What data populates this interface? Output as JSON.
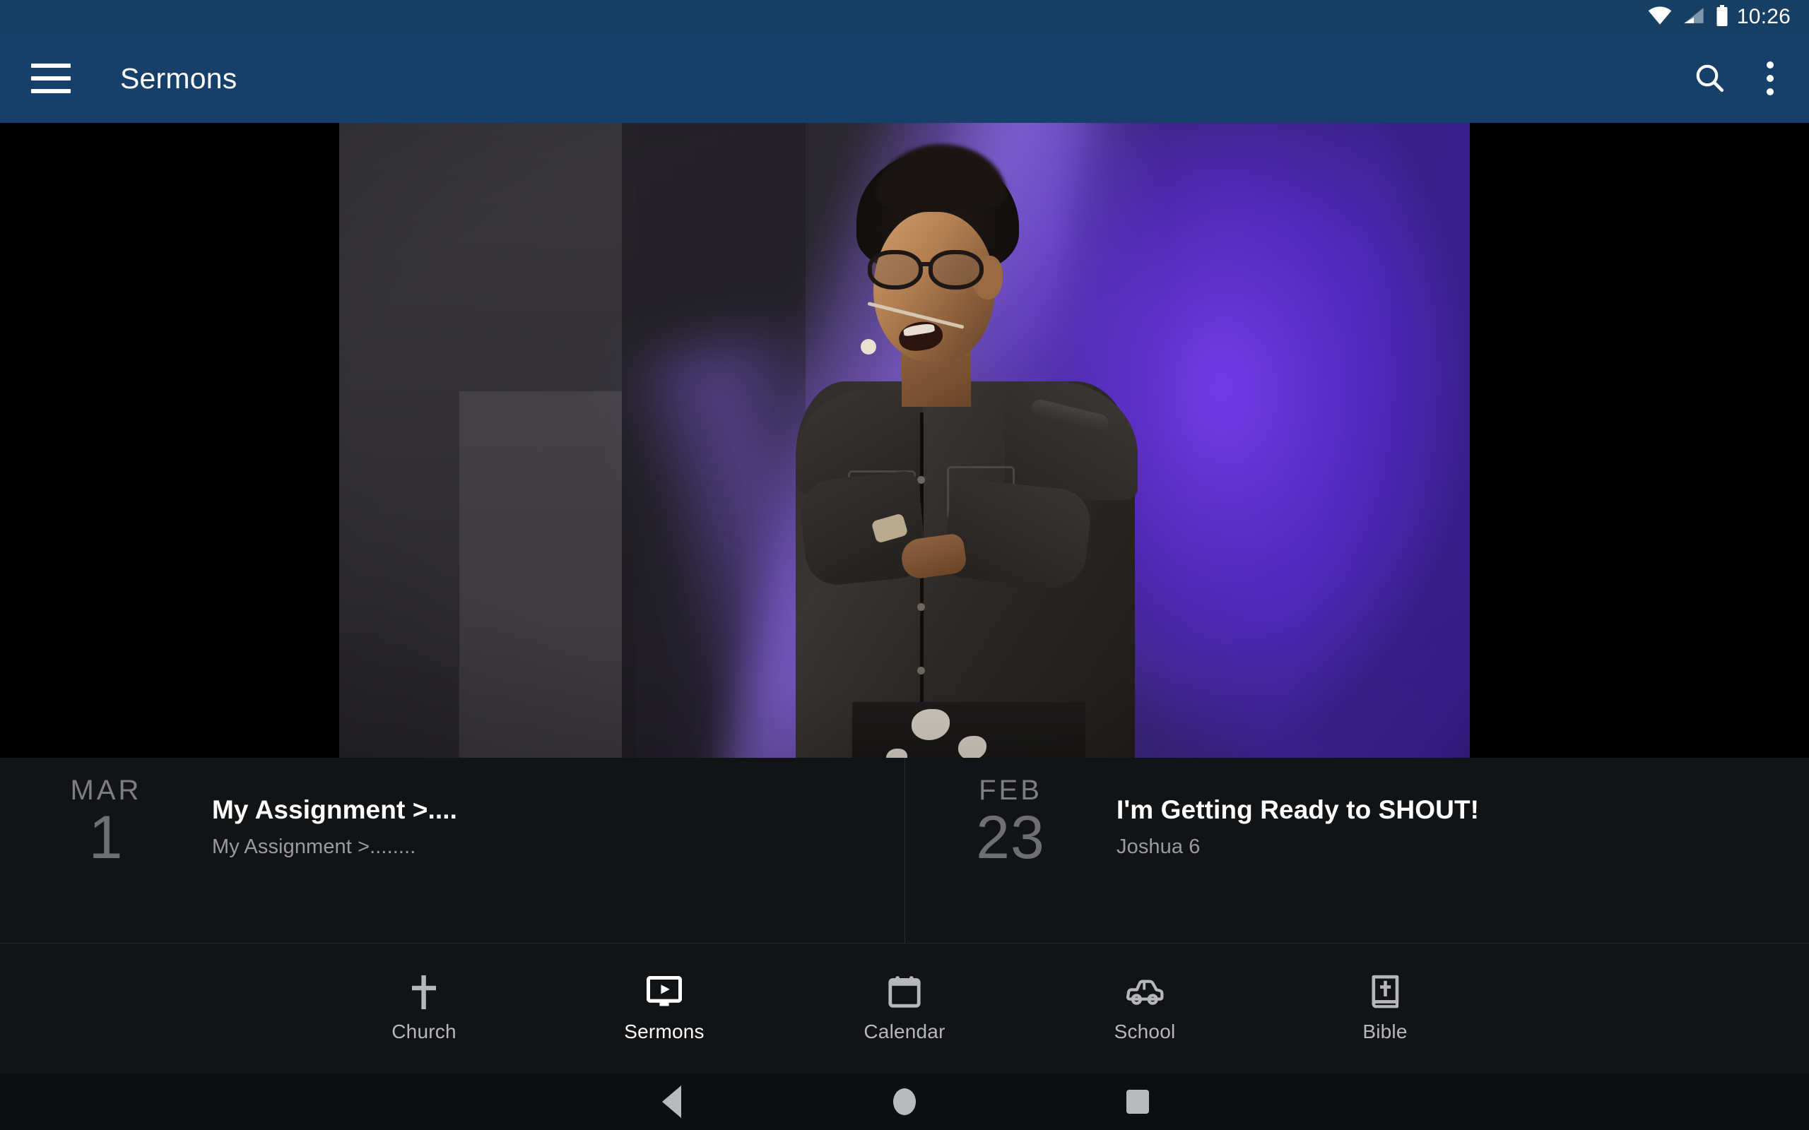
{
  "status_bar": {
    "time": "10:26",
    "icons": [
      "wifi-icon",
      "cellular-signal-icon",
      "battery-icon"
    ]
  },
  "app_bar": {
    "menu_icon": "hamburger-menu-icon",
    "title": "Sermons",
    "search_icon": "search-icon",
    "overflow_icon": "more-vertical-icon",
    "background_color": "#164069"
  },
  "hero": {
    "name": "sermon-video-thumbnail",
    "description": "Speaker with glasses and headset microphone on a stage with purple lighting",
    "letterbox_color": "#000000"
  },
  "list": {
    "items": [
      {
        "month": "MAR",
        "day": "1",
        "title": "My Assignment >....",
        "subtitle": "My Assignment  >........"
      },
      {
        "month": "FEB",
        "day": "23",
        "title": "I'm Getting Ready to SHOUT!",
        "subtitle": "Joshua 6"
      }
    ]
  },
  "bottom_nav": {
    "active": "Sermons",
    "items": [
      {
        "label": "Church",
        "icon": "cross-icon",
        "active": false
      },
      {
        "label": "Sermons",
        "icon": "video-monitor-icon",
        "active": true
      },
      {
        "label": "Calendar",
        "icon": "calendar-icon",
        "active": false
      },
      {
        "label": "School",
        "icon": "car-icon",
        "active": false
      },
      {
        "label": "Bible",
        "icon": "book-cross-icon",
        "active": false
      }
    ]
  },
  "system_nav": {
    "back": "back-triangle-icon",
    "home": "home-circle-icon",
    "recents": "recents-square-icon"
  }
}
